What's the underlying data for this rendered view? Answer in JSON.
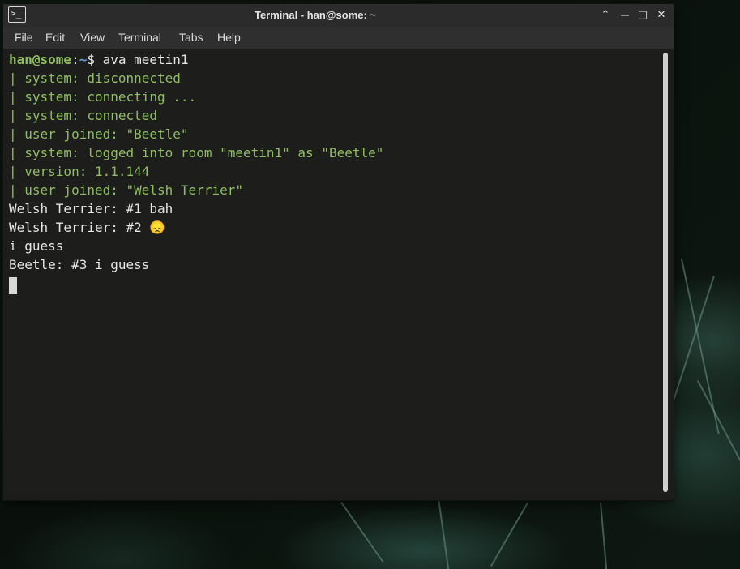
{
  "window": {
    "title": "Terminal - han@some: ~",
    "controls": {
      "up": "⌃",
      "minimize": "—",
      "maximize": "□",
      "close": "✕"
    }
  },
  "menubar": {
    "items": [
      "File",
      "Edit",
      "View",
      "Terminal",
      "Tabs",
      "Help"
    ]
  },
  "terminal": {
    "prompt_user": "han@some",
    "prompt_sep": ":",
    "prompt_path": "~",
    "prompt_symbol": "$ ",
    "command": "ava meetin1",
    "system_lines": [
      "| system: disconnected",
      "| system: connecting ...",
      "| system: connected",
      "| user joined: \"Beetle\"",
      "| system: logged into room \"meetin1\" as \"Beetle\"",
      "| version: 1.1.144",
      "| user joined: \"Welsh Terrier\""
    ],
    "chat_lines": [
      "Welsh Terrier: #1 bah",
      "Welsh Terrier: #2 😞",
      "i guess",
      "Beetle: #3 i guess"
    ]
  },
  "icons": {
    "app": "terminal-icon"
  }
}
